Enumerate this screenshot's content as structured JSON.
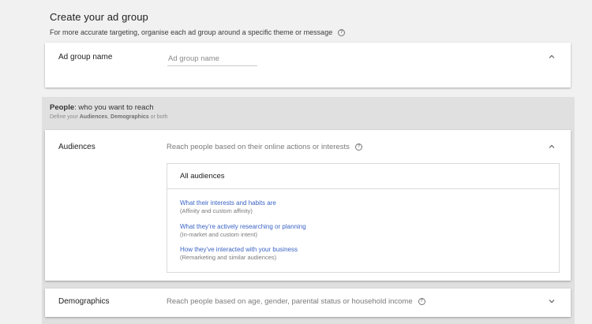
{
  "header": {
    "title": "Create your ad group",
    "subtitle": "For more accurate targeting, organise each ad group around a specific theme or message"
  },
  "ad_group_card": {
    "label": "Ad group name",
    "input_value": "",
    "input_placeholder": "Ad group name"
  },
  "people": {
    "heading_bold": "People",
    "heading_rest": ": who you want to reach",
    "desc_prefix": "Define your ",
    "desc_audiences": "Audiences",
    "desc_sep": ", ",
    "desc_demographics": "Demographics",
    "desc_suffix": " or both"
  },
  "audiences_card": {
    "label": "Audiences",
    "description": "Reach people based on their online actions or interests",
    "box_header": "All audiences",
    "options": [
      {
        "link": "What their interests and habits are",
        "sub": "(Affinity and custom affinity)"
      },
      {
        "link": "What they’re actively researching or planning",
        "sub": "(In-market and custom intent)"
      },
      {
        "link": "How they’ve interacted with your business",
        "sub": "(Remarketing and similar audiences)"
      }
    ]
  },
  "demographics_card": {
    "label": "Demographics",
    "description": "Reach people based on age, gender, parental status or household income"
  },
  "icons": {
    "help": "?",
    "chevron_up": "chevron-up-icon",
    "chevron_down": "chevron-down-icon"
  },
  "colors": {
    "link": "#3b64c4",
    "background": "#f1f1f1",
    "section_background": "#e0e0e0"
  }
}
